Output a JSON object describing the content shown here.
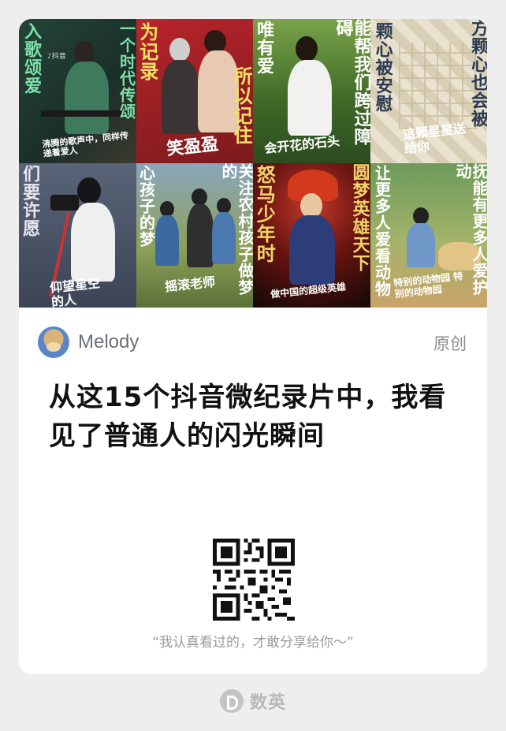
{
  "posters": [
    {
      "text_main": "入歌颂爱",
      "text_side": "一个时代传颂",
      "caption": "沸腾的歌声中，同样传递着爱人"
    },
    {
      "text_main": "为记录",
      "text_side": "所以记住",
      "caption": "笑盈盈"
    },
    {
      "text_main": "唯有爱",
      "text_side": "能帮我们跨过障碍",
      "caption": "会开花的石头"
    },
    {
      "text_main": "颗心被安慰",
      "text_side": "方颗心也会被",
      "caption": "這顆星星送给你"
    },
    {
      "text_main": "们要许愿",
      "text_side": "",
      "caption": "仰望星空的人"
    },
    {
      "text_main": "心孩子的梦",
      "text_side": "关注农村孩子做梦的",
      "caption": "摇滚老师"
    },
    {
      "text_main": "怒马少年时",
      "text_side": "圆梦英雄天下",
      "caption": "做中国的超级英雄"
    },
    {
      "text_main": "让更多人爱看动物",
      "text_side": "抚能有更多人爱护动",
      "caption": "特别的动物园 特别的动物园"
    }
  ],
  "author": {
    "name": "Melody",
    "badge": "原创"
  },
  "article": {
    "title": "从这15个抖音微纪录片中，我看见了普通人的闪光瞬间"
  },
  "share": {
    "caption": "“我认真看过的，才敢分享给你～”"
  },
  "footer": {
    "brand": "数英"
  }
}
